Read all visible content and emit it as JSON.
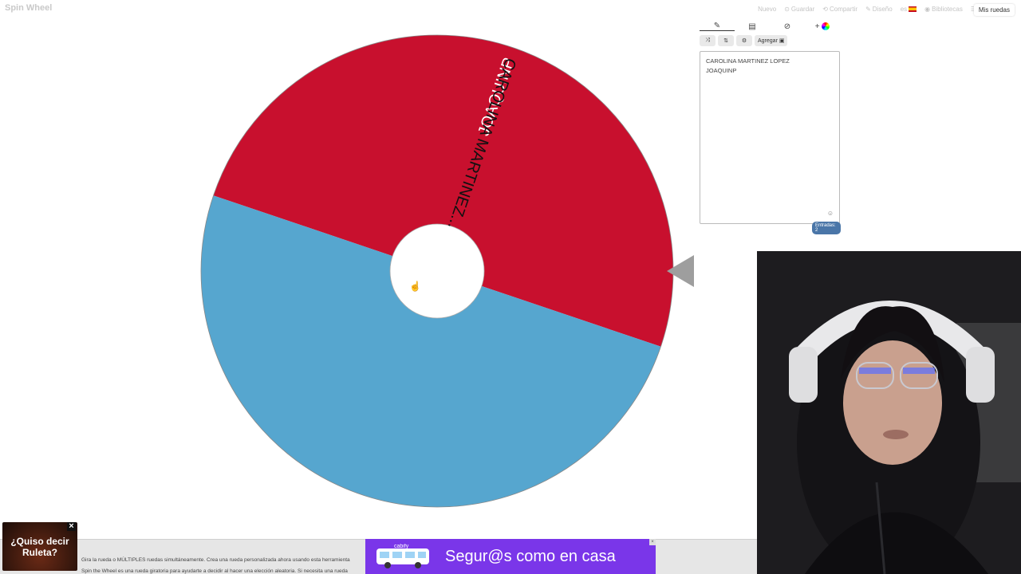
{
  "app": {
    "logo": "Spin Wheel"
  },
  "topnav": {
    "items": [
      "Nuevo",
      "Guardar",
      "Compartir",
      "Diseño"
    ],
    "lang": "es",
    "library": "Bibliotecas",
    "my_wheels": "Mis ruedas"
  },
  "wheel": {
    "segments": [
      {
        "label": "JOAQUINP",
        "color": "#c8102e"
      },
      {
        "label": "CAROLINA MARTINEZ...",
        "color": "#56a6cf"
      }
    ]
  },
  "editor": {
    "add_label": "Agregar",
    "entries": [
      "CAROLINA MARTINEZ LOPEZ",
      "JOAQUINP"
    ],
    "count_label": "Entradas: 2"
  },
  "bottom": {
    "ad_left_text": "¿Quiso decir Ruleta?",
    "desc_line1": "Gira la rueda o MÚLTIPLES ruedas simultáneamente. Crea una rueda personalizada ahora usando esta herramienta",
    "desc_line2": "Spin the Wheel es una rueda giratoria para ayudarte a decidir al hacer una elección aleatoria. Si necesita una rueda",
    "banner_brand": "cabify",
    "banner_slogan": "Segur@s como en casa"
  }
}
